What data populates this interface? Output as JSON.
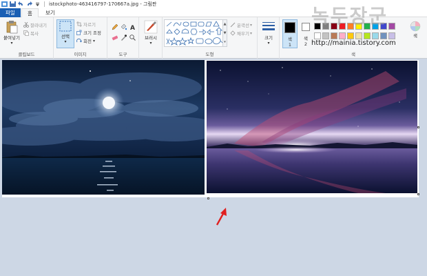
{
  "window": {
    "title": "istockphoto-463416797-170667a.jpg - 그림판"
  },
  "tabs": [
    {
      "label": "파일"
    },
    {
      "label": "홈"
    },
    {
      "label": "보기"
    }
  ],
  "ribbon": {
    "clipboard": {
      "paste": "붙여넣기",
      "cut": "잘라내기",
      "copy": "복사",
      "label": "클립보드"
    },
    "image": {
      "select": "선택",
      "crop": "자르기",
      "resize": "크기 조정",
      "rotate": "회전",
      "label": "이미지"
    },
    "tools": {
      "label": "도구"
    },
    "brushes": {
      "label": "브러시"
    },
    "shapes": {
      "outline": "윤곽선",
      "fill": "채우기",
      "label": "도형"
    },
    "size": {
      "label": "크기"
    },
    "colors": {
      "color1": "색",
      "color1_num": "1",
      "color2": "색",
      "color2_num": "2",
      "edit": "색",
      "label": "색"
    }
  },
  "watermark": {
    "big": "녹두장군",
    "url": "http://mainia.tistory.com"
  },
  "colors": {
    "file_tab": "#1a5fb4",
    "workspace": "#cdd7e5",
    "arrow": "#e02020"
  }
}
